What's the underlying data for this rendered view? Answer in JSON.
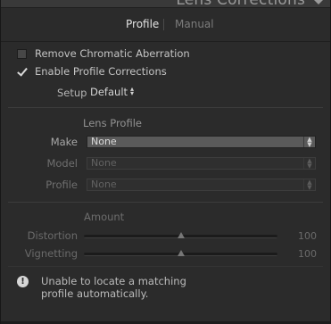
{
  "panel": {
    "title": "Lens Corrections"
  },
  "tabs": {
    "profile": "Profile",
    "manual": "Manual"
  },
  "options": {
    "remove_ca": {
      "label": "Remove Chromatic Aberration",
      "checked": false
    },
    "enable_profile": {
      "label": "Enable Profile Corrections",
      "checked": true
    }
  },
  "setup": {
    "label": "Setup",
    "value": "Default"
  },
  "lens_profile": {
    "heading": "Lens Profile",
    "make": {
      "label": "Make",
      "value": "None"
    },
    "model": {
      "label": "Model",
      "value": "None"
    },
    "profile": {
      "label": "Profile",
      "value": "None"
    }
  },
  "amount": {
    "heading": "Amount",
    "distortion": {
      "label": "Distortion",
      "value": "100",
      "fraction": 0.5
    },
    "vignetting": {
      "label": "Vignetting",
      "value": "100",
      "fraction": 0.5
    }
  },
  "warning": {
    "line1": "Unable to locate a matching",
    "line2": "profile automatically."
  },
  "colors": {
    "panel_bg": "#2b2b2b",
    "header_bg": "#393939",
    "active_text": "#e3e3e3"
  }
}
